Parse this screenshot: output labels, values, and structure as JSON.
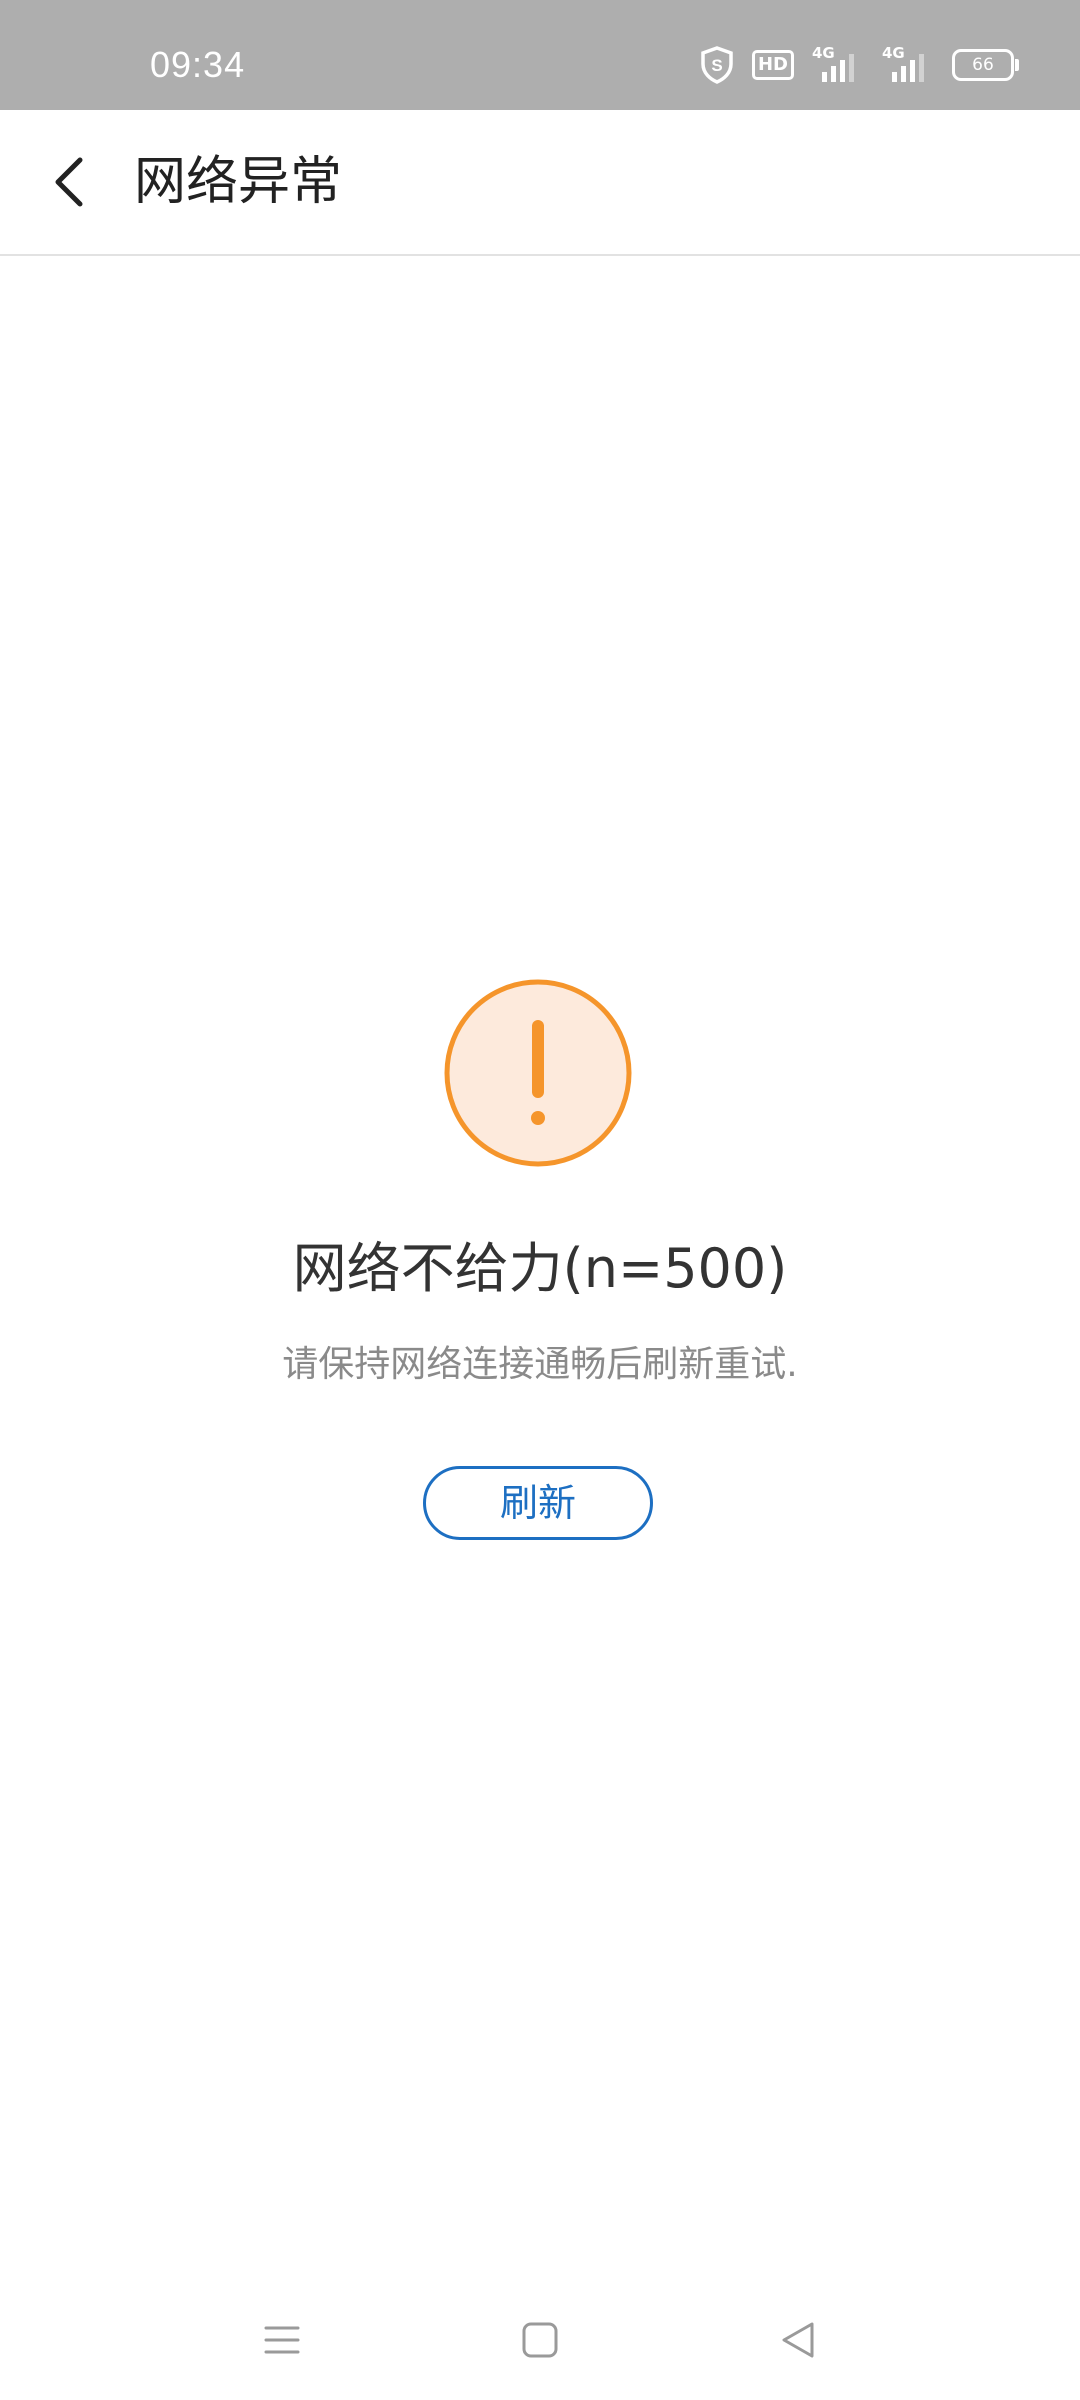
{
  "status_bar": {
    "time": "09:34",
    "icons": [
      "shield-icon",
      "hd-icon",
      "signal-4g-icon",
      "signal-4g-icon",
      "battery-icon"
    ],
    "hd_label": "HD",
    "network_label": "4G",
    "battery_level": "66"
  },
  "app_bar": {
    "back_icon": "chevron-left-icon",
    "title": "网络异常"
  },
  "error": {
    "icon": "exclamation-circle-icon",
    "accent_color": "#f5952b",
    "accent_fill": "#fdeadc",
    "title": "网络不给力(n=500)",
    "subtitle": "请保持网络连接通畅后刷新重试.",
    "refresh_label": "刷新",
    "button_color": "#1d6fc2"
  },
  "nav_bar": {
    "icons": [
      "menu-icon",
      "home-square-icon",
      "back-triangle-icon"
    ]
  }
}
